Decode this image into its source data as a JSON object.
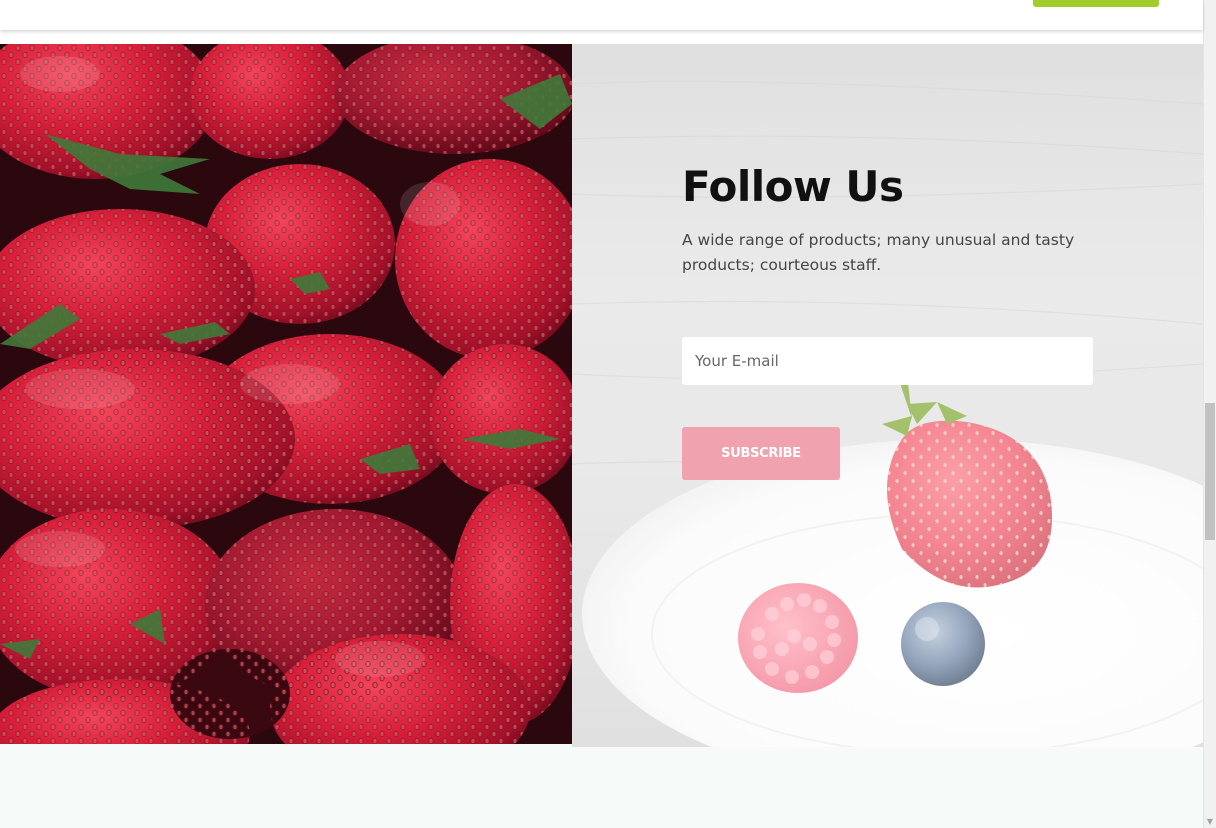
{
  "follow": {
    "title": "Follow Us",
    "description": "A wide range of products; many unusual and tasty products; courteous staff."
  },
  "subscribe_form": {
    "email_placeholder": "Your E-mail",
    "button_label": "SUBSCRIBE"
  },
  "colors": {
    "header_cta": "#9fce2b",
    "subscribe_button": "#f0a2af",
    "lower_section_bg": "#f6fbf9"
  },
  "images": {
    "left": "strawberries-pile-photo",
    "right": "berries-on-white-plate-photo"
  },
  "icons": {
    "scroll_down": "chevron-down-icon"
  }
}
